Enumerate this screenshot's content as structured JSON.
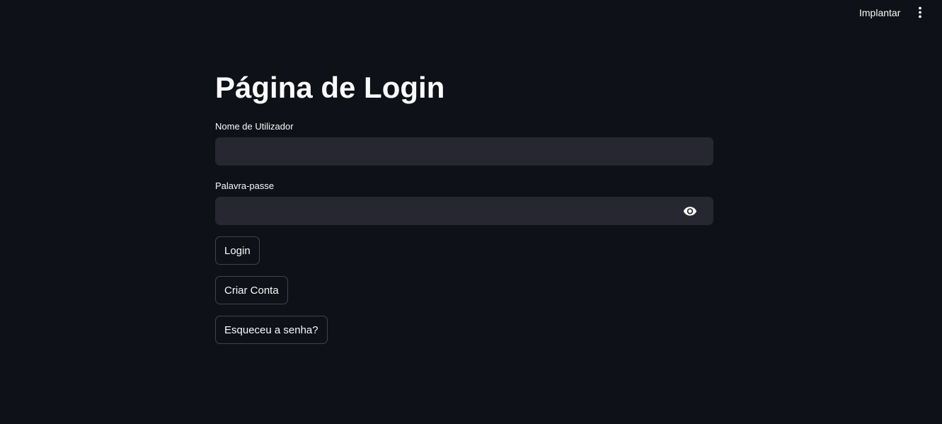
{
  "header": {
    "deploy_label": "Implantar",
    "menu_icon": "vertical-dots-icon"
  },
  "main": {
    "title": "Página de Login",
    "username": {
      "label": "Nome de Utilizador",
      "value": "",
      "placeholder": ""
    },
    "password": {
      "label": "Palavra-passe",
      "value": "",
      "placeholder": "",
      "toggle_icon": "eye-icon"
    },
    "buttons": {
      "login": "Login",
      "create_account": "Criar Conta",
      "forgot_password": "Esqueceu a senha?"
    }
  },
  "colors": {
    "background": "#0e1117",
    "input_background": "#262730",
    "text": "#fafafa"
  }
}
